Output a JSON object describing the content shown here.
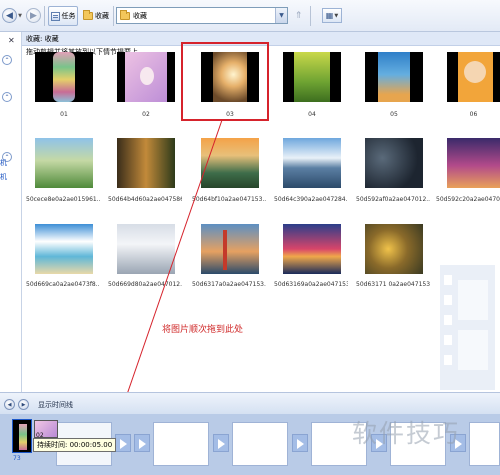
{
  "toolbar": {
    "back_label": "",
    "tasks_label": "任务",
    "favorites_label": "收藏",
    "address_value": "收藏"
  },
  "left_pane": {
    "text_1": "机",
    "text_2": "机"
  },
  "collection": {
    "title": "收藏: 收藏",
    "hint": "拖动剪辑并将其放到以下情节提要上。"
  },
  "clips": [
    {
      "name": "01"
    },
    {
      "name": "02"
    },
    {
      "name": "03"
    },
    {
      "name": "04"
    },
    {
      "name": "05"
    },
    {
      "name": "06"
    },
    {
      "name": "50cece8e0a2ae015961..."
    },
    {
      "name": "50d64b4d60a2ae047586..."
    },
    {
      "name": "50d64bf10a2ae047153..."
    },
    {
      "name": "50d64c390a2ae047284..."
    },
    {
      "name": "50d592af0a2ae047012..."
    },
    {
      "name": "50d592c20a2ae047012..."
    },
    {
      "name": "50d669ca0a2ae0473f8..."
    },
    {
      "name": "50d669d80a2ae047012..."
    },
    {
      "name": "50d6317a0a2ae047153..."
    },
    {
      "name": "50d63169a0a2ae047153..."
    },
    {
      "name": "50d63171 0a2ae047153..."
    }
  ],
  "annotation": "将图片顺次拖到此处",
  "timeline": {
    "toggle_label": "显示时间线"
  },
  "storyboard": {
    "first_clip_number": "73",
    "tooltip_name": "02",
    "tooltip_text": "持续时间: 00:00:05.00"
  },
  "watermark": "软件技巧",
  "colors": {
    "highlight": "#d6232c",
    "annotation": "#d02a2a",
    "storyboard_bg": "#b9cbe7"
  },
  "icons": [
    "back-arrow-icon",
    "forward-arrow-icon",
    "tasks-icon",
    "folder-icon",
    "up-icon",
    "views-icon",
    "play-icon",
    "rewind-icon"
  ]
}
